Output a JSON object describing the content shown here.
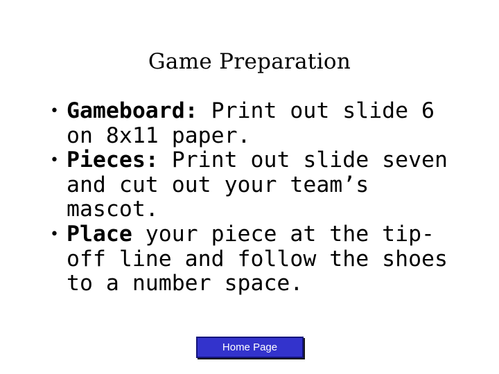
{
  "slide": {
    "title": "Game Preparation",
    "background_color": "#FFFFFF",
    "text_color": "#000000"
  },
  "body": {
    "bullet_glyph": "•",
    "items": [
      {
        "lead": "Gameboard:",
        "rest": " Print out slide 6 on 8x11 paper.",
        "full_text": "Gameboard: Print out slide 6 on 8x11 paper."
      },
      {
        "lead": "Pieces:",
        "rest": " Print out slide seven and cut out your team’s mascot.",
        "full_text": "Pieces: Print out slide seven and cut out your team’s mascot."
      },
      {
        "lead": "Place",
        "rest": " your piece at the tip-off line and follow the shoes to a number space.",
        "full_text": "Place your piece at the tip-off line and follow the shoes to a number space."
      }
    ]
  },
  "home_button": {
    "label": "Home Page",
    "fill_color": "#3333CC",
    "border_color": "#13137A",
    "text_color": "#FFFFFF"
  }
}
